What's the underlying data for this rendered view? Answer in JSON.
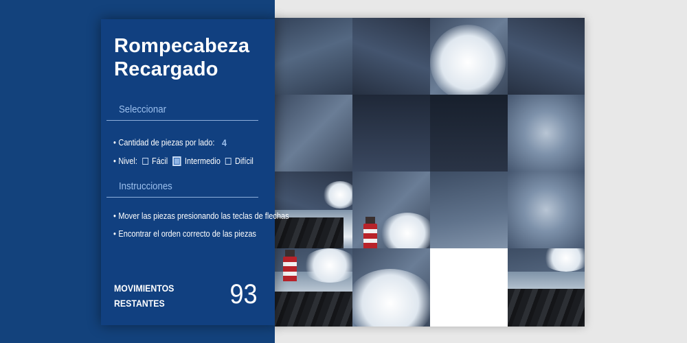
{
  "panel": {
    "title_line1": "Rompecabeza",
    "title_line2": "Recargado",
    "select_heading": "Seleccionar",
    "pieces_label": "Cantidad de piezas por lado:",
    "pieces_value": "4",
    "level_label": "Nivel:",
    "levels": [
      {
        "label": "Fácil",
        "selected": false
      },
      {
        "label": "Intermedio",
        "selected": true
      },
      {
        "label": "Difícil",
        "selected": false
      }
    ],
    "instructions_heading": "Instrucciones",
    "instructions": [
      "Mover las piezas presionando las teclas de flechas",
      "Encontrar el orden correcto de las piezas"
    ],
    "moves_label_line1": "MOVIMIENTOS",
    "moves_label_line2": "RESTANTES",
    "moves_value": "93"
  },
  "bullet": "•",
  "board": {
    "grid": "4x4",
    "empty_tile": {
      "row": 4,
      "col": 3
    }
  },
  "colors": {
    "panel_bg": "#114080",
    "accent_text": "#9cc0ee",
    "page_bg": "#e8e8e8"
  }
}
